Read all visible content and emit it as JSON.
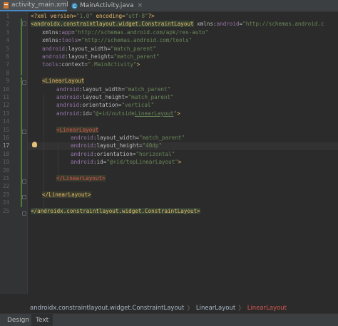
{
  "tabs": [
    {
      "label": "activity_main.xml",
      "active": true
    },
    {
      "label": "MainActivity.java",
      "active": false
    }
  ],
  "editor": {
    "line_numbers": [
      "1",
      "2",
      "3",
      "4",
      "5",
      "6",
      "7",
      "8",
      "9",
      "10",
      "11",
      "12",
      "13",
      "14",
      "15",
      "16",
      "17",
      "18",
      "19",
      "20",
      "21",
      "22",
      "23",
      "24",
      "25"
    ],
    "lines": {
      "l1": [
        "<?xml version=",
        "\"1.0\"",
        " encoding=",
        "\"utf-8\"",
        "?>"
      ],
      "l2": [
        "<androidx.constraintlayout.widget.ConstraintLayout",
        " xmlns:",
        "android",
        "=",
        "\"http://schemas.android.c"
      ],
      "l3": [
        "xmlns:",
        "app",
        "=",
        "\"http://schemas.android.com/apk/res-auto\""
      ],
      "l4": [
        "xmlns:",
        "tools",
        "=",
        "\"http://schemas.android.com/tools\""
      ],
      "l5": [
        "android",
        ":layout_width=",
        "\"match_parent\""
      ],
      "l6": [
        "android",
        ":layout_height=",
        "\"match_parent\""
      ],
      "l7": [
        "tools",
        ":context=",
        "\".MainActivity\"",
        ">"
      ],
      "l9": [
        "<LinearLayout"
      ],
      "l10": [
        "android",
        ":layout_width=",
        "\"match_parent\""
      ],
      "l11": [
        "android",
        ":layout_height=",
        "\"match_parent\""
      ],
      "l12": [
        "android",
        ":orientation=",
        "\"vertical\""
      ],
      "l13": [
        "android",
        ":id=",
        "\"@+id/outside",
        "LinearLayout",
        "\"",
        ">"
      ],
      "l15": [
        "<LinearLayout"
      ],
      "l16": [
        "android",
        ":layout_width=",
        "\"match_parent\""
      ],
      "l17": [
        "android",
        ":layout_height=",
        "\"40dp\""
      ],
      "l18": [
        "android",
        ":orientation=",
        "\"horizontal\""
      ],
      "l19": [
        "android",
        ":id=",
        "\"@+id/topLinearLayout\"",
        ">"
      ],
      "l21": [
        "</LinearLayout>"
      ],
      "l23": [
        "</LinearLayout>"
      ],
      "l25": [
        "</androidx.constraintlayout.widget.ConstraintLayout>"
      ]
    }
  },
  "breadcrumb": [
    "androidx.constraintlayout.widget.ConstraintLayout",
    "LinearLayout",
    "LinearLayout"
  ],
  "bottom_tabs": [
    {
      "label": "Design",
      "active": false
    },
    {
      "label": "Text",
      "active": true
    }
  ],
  "colors": {
    "tag": "#e8bf6a",
    "namespace": "#9876aa",
    "value": "#6a8759",
    "modified_bar": "#4e7d3a",
    "error_crumb": "#d8574f"
  }
}
